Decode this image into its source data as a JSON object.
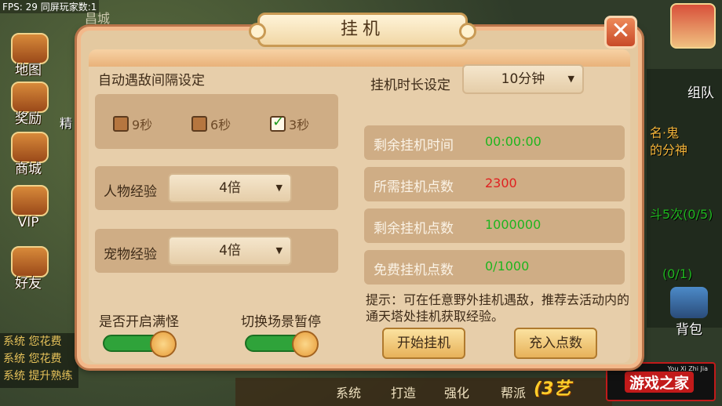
{
  "hud": {
    "fps": "FPS: 29 同屏玩家数:1",
    "city": "昌城",
    "left_menu": [
      "地图",
      "奖励",
      "商城",
      "VIP",
      "好友"
    ],
    "peek_jing": "精",
    "team": "组队",
    "backpack": "背包",
    "chat_lines": [
      "系统 您花费",
      "系统 您花费",
      "系统 提升熟练"
    ],
    "bottom_menu": [
      "系统",
      "打造",
      "强化",
      "帮派"
    ],
    "right_peek": [
      "名·鬼",
      "的分神",
      "斗5次(0/5)",
      "(0/1)"
    ],
    "watermark": "游戏之家",
    "watermark_small": "You Xi Zhi Jia",
    "logo_text": "(3艺"
  },
  "dialog": {
    "title": "挂机",
    "close_label": "✕",
    "auto_encounter_label": "自动遇敌间隔设定",
    "intervals": [
      {
        "label": "9秒",
        "checked": false
      },
      {
        "label": "6秒",
        "checked": false
      },
      {
        "label": "3秒",
        "checked": true
      }
    ],
    "char_exp_label": "人物经验",
    "char_exp_value": "4倍",
    "pet_exp_label": "宠物经验",
    "pet_exp_value": "4倍",
    "duration_label": "挂机时长设定",
    "duration_value": "10分钟",
    "stats": [
      {
        "key": "剩余挂机时间",
        "value": "00:00:00",
        "color": "#1fb51f"
      },
      {
        "key": "所需挂机点数",
        "value": "2300",
        "color": "#e02020"
      },
      {
        "key": "剩余挂机点数",
        "value": "1000000",
        "color": "#1fb51f"
      },
      {
        "key": "免费挂机点数",
        "value": "0/1000",
        "color": "#1fb51f"
      }
    ],
    "tip": "提示：可在任意野外挂机遇敌，推荐去活动内的通天塔处挂机获取经验。",
    "full_monster_label": "是否开启满怪",
    "full_monster_on": true,
    "pause_switch_label": "切换场景暂停",
    "pause_switch_on": true,
    "start_button": "开始挂机",
    "recharge_button": "充入点数"
  }
}
